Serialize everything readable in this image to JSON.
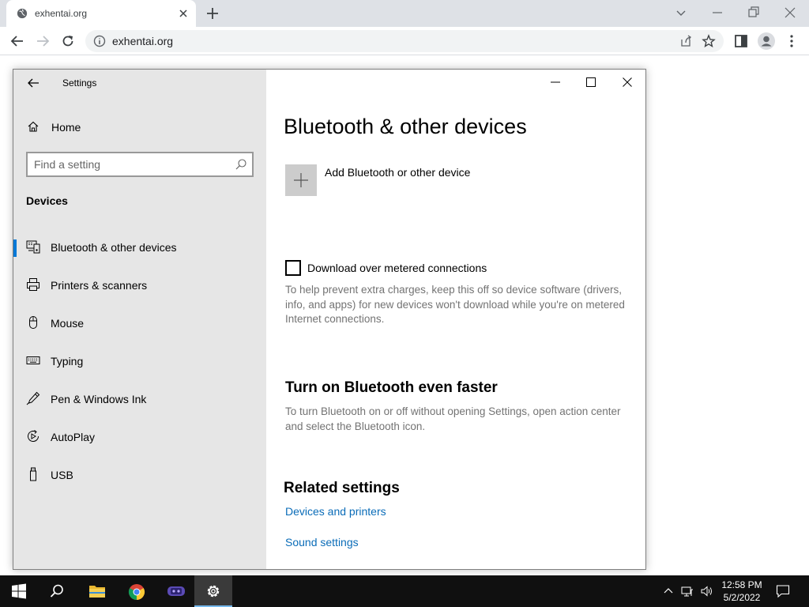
{
  "browser": {
    "tab_title": "exhentai.org",
    "url": "exhentai.org"
  },
  "settings": {
    "app_title": "Settings",
    "home_label": "Home",
    "search_placeholder": "Find a setting",
    "section_label": "Devices",
    "nav_items": [
      {
        "label": "Bluetooth & other devices",
        "icon": "bluetooth-devices-icon",
        "active": true
      },
      {
        "label": "Printers & scanners",
        "icon": "printer-icon",
        "active": false
      },
      {
        "label": "Mouse",
        "icon": "mouse-icon",
        "active": false
      },
      {
        "label": "Typing",
        "icon": "keyboard-icon",
        "active": false
      },
      {
        "label": "Pen & Windows Ink",
        "icon": "pen-icon",
        "active": false
      },
      {
        "label": "AutoPlay",
        "icon": "autoplay-icon",
        "active": false
      },
      {
        "label": "USB",
        "icon": "usb-icon",
        "active": false
      }
    ],
    "content": {
      "title": "Bluetooth & other devices",
      "add_device_label": "Add Bluetooth or other device",
      "metered_label": "Download over metered connections",
      "metered_checked": false,
      "metered_desc": "To help prevent extra charges, keep this off so device software (drivers, info, and apps) for new devices won't download while you're on metered Internet connections.",
      "faster_heading": "Turn on Bluetooth even faster",
      "faster_desc": "To turn Bluetooth on or off without opening Settings, open action center and select the Bluetooth icon.",
      "related_heading": "Related settings",
      "links": [
        "Devices and printers",
        "Sound settings"
      ]
    }
  },
  "taskbar": {
    "time": "12:58 PM",
    "date": "5/2/2022",
    "apps": [
      "start-icon",
      "search-icon",
      "file-explorer-icon",
      "chrome-icon",
      "app-icon",
      "settings-icon"
    ]
  },
  "colors": {
    "accent": "#0078d7",
    "link": "#0a6cb8",
    "nav_bg": "#e6e6e6",
    "taskbar_bg": "#101010"
  }
}
